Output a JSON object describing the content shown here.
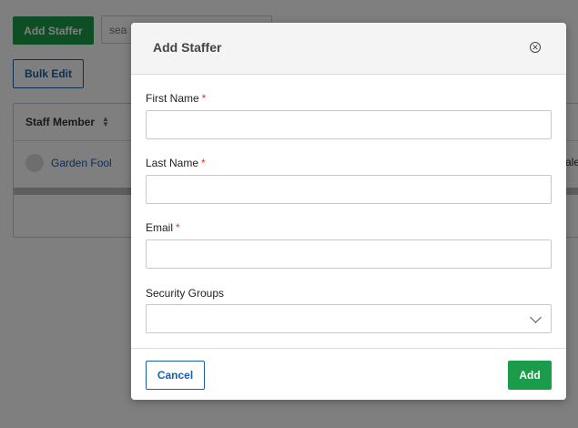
{
  "toolbar": {
    "add_staffer_label": "Add Staffer",
    "search_placeholder": "sea",
    "bulk_edit_label": "Bulk Edit"
  },
  "table": {
    "columns": [
      "Staff Member"
    ],
    "rows": [
      {
        "name": "Garden Fool",
        "tail": "ale"
      }
    ]
  },
  "modal": {
    "title": "Add Staffer",
    "fields": [
      {
        "label": "First Name",
        "required": "*",
        "value": ""
      },
      {
        "label": "Last Name",
        "required": "*",
        "value": ""
      },
      {
        "label": "Email",
        "required": "*",
        "value": ""
      },
      {
        "label": "Security Groups",
        "value": ""
      }
    ],
    "cancel_label": "Cancel",
    "add_label": "Add"
  },
  "colors": {
    "primary_green": "#1a9c4b",
    "link_blue": "#1a5fa8",
    "required_red": "#d33333"
  },
  "icons": [
    "sort-icon",
    "close-icon",
    "chevron-down-icon",
    "avatar"
  ]
}
